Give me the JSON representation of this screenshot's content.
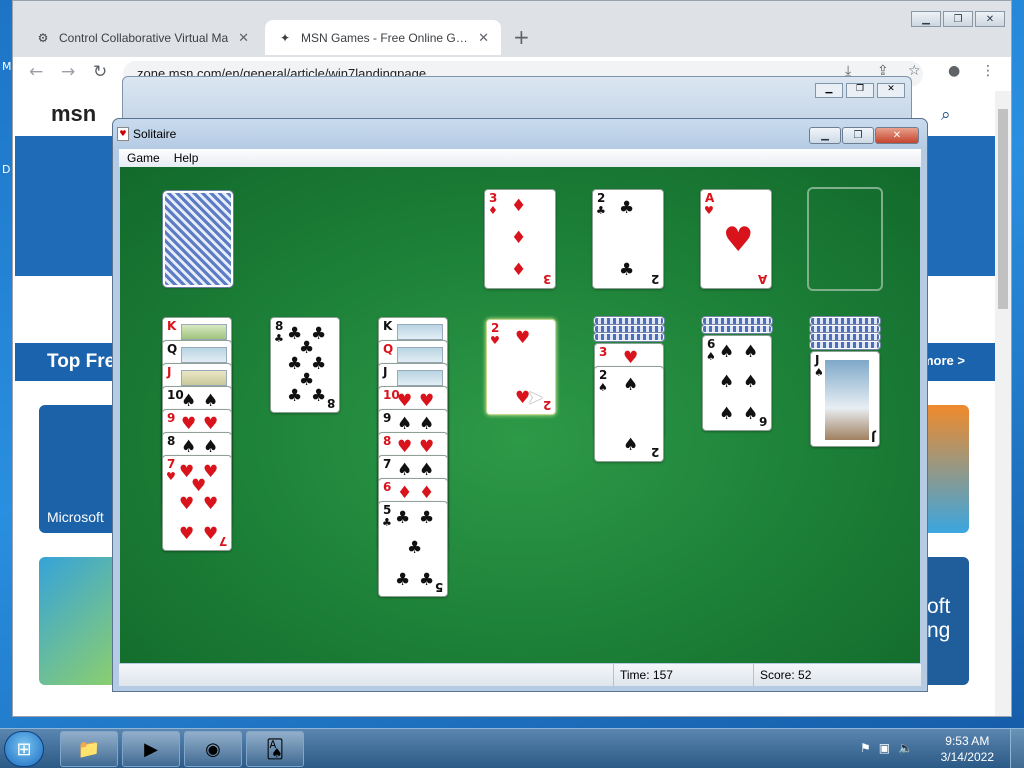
{
  "desktop": {
    "fragment_top": "M",
    "fragment_mid": "D"
  },
  "browser": {
    "tabs": [
      {
        "title": "Control Collaborative Virtual Ma",
        "close": "✕"
      },
      {
        "title": "MSN Games - Free Online Game",
        "close": "✕"
      }
    ],
    "new_tab": "+",
    "url": "zone.msn.com/en/general/article/win7landingpage",
    "page": {
      "logo": "msn",
      "top_free_heading": "Top Fre",
      "more_link": "more >",
      "tile_caption": "Microsoft",
      "right_tile_text": "oft ng"
    }
  },
  "solitaire": {
    "title": "Solitaire",
    "menu": [
      "Game",
      "Help"
    ],
    "status": {
      "time_label": "Time:",
      "time_value": "157",
      "score_label": "Score:",
      "score_value": "52"
    },
    "foundations": [
      {
        "rank": "3",
        "suit": "♦",
        "color": "red"
      },
      {
        "rank": "2",
        "suit": "♣",
        "color": "black"
      },
      {
        "rank": "A",
        "suit": "♥",
        "color": "red"
      },
      {
        "rank": "",
        "suit": "",
        "color": "empty"
      }
    ],
    "tableau": [
      [
        "K",
        "Q",
        "J",
        "10",
        "9",
        "8",
        "7"
      ],
      [
        "8"
      ],
      [
        "K",
        "Q",
        "J",
        "10",
        "9",
        "8",
        "7",
        "6",
        "5"
      ],
      [
        "2"
      ],
      [
        "3",
        "2"
      ],
      [
        "6"
      ],
      [
        "J"
      ]
    ]
  },
  "taskbar": {
    "time": "9:53 AM",
    "date": "3/14/2022"
  }
}
